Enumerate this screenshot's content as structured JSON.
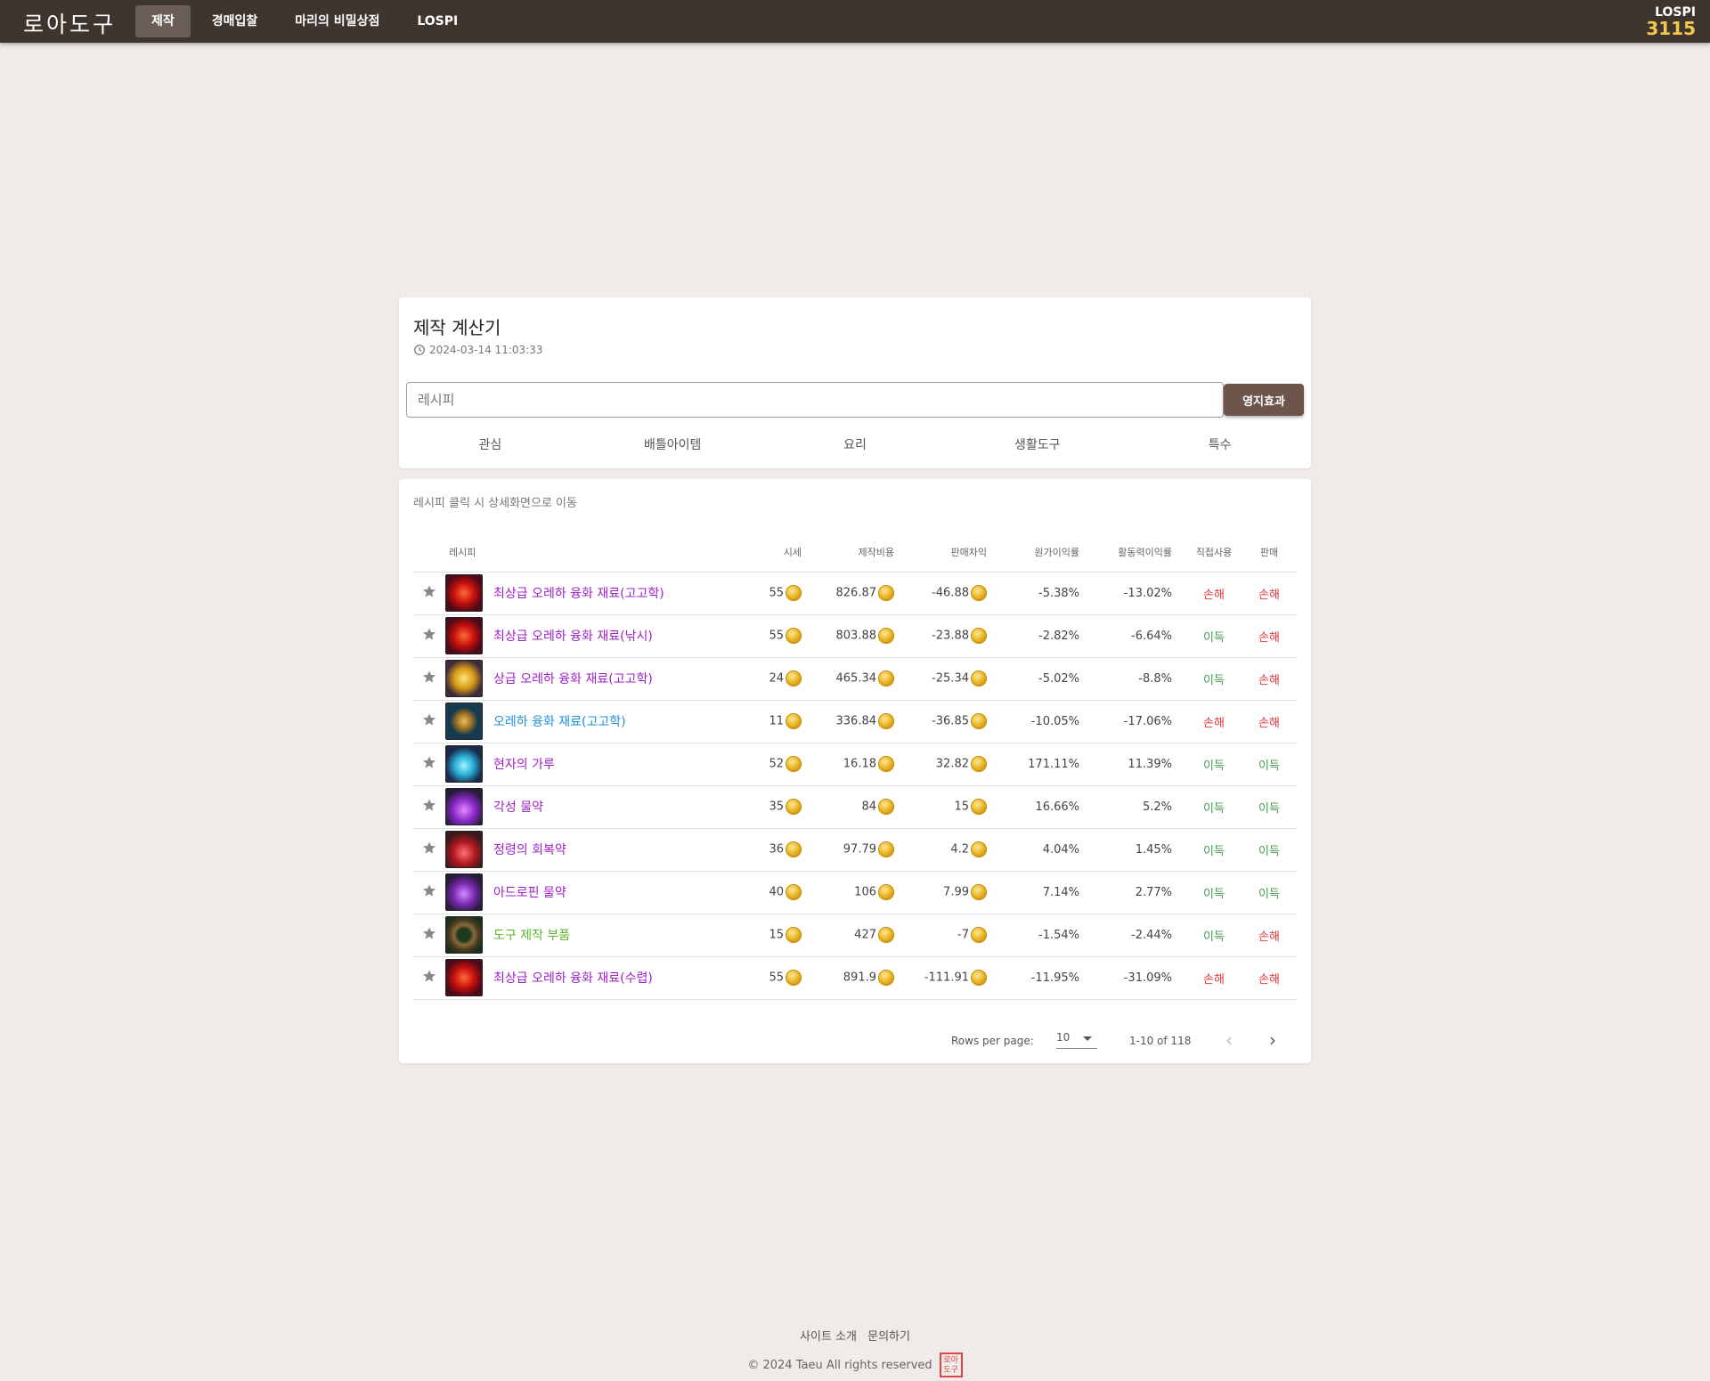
{
  "header": {
    "logo": "로아도구",
    "nav": [
      "제작",
      "경매입찰",
      "마리의 비밀상점",
      "LOSPI"
    ],
    "lospi_label": "LOSPI",
    "lospi_value": "3115"
  },
  "calculator": {
    "title": "제작 계산기",
    "timestamp": "2024-03-14 11:03:33",
    "search_placeholder": "레시피",
    "effect_button": "영지효과",
    "tabs": [
      "관심",
      "배틀아이템",
      "요리",
      "생활도구",
      "특수"
    ]
  },
  "table": {
    "hint": "레시피 클릭 시 상세화면으로 이동",
    "headers": [
      "레시피",
      "시세",
      "제작비용",
      "판매차익",
      "원가이익률",
      "활동력이익률",
      "직접사용",
      "판매"
    ],
    "rows": [
      {
        "name": "최상급 오레하 융화 재료(고고학)",
        "name_color": "#a020c8",
        "icon": "red-gem-icon",
        "price": "55",
        "cost": "826.87",
        "profit": "-46.88",
        "cost_rate": "-5.38%",
        "energy_rate": "-13.02%",
        "use": "손해",
        "sell": "손해"
      },
      {
        "name": "최상급 오레하 융화 재료(낚시)",
        "name_color": "#a020c8",
        "icon": "red-gem-icon",
        "price": "55",
        "cost": "803.88",
        "profit": "-23.88",
        "cost_rate": "-2.82%",
        "energy_rate": "-6.64%",
        "use": "이득",
        "sell": "손해"
      },
      {
        "name": "상급 오레하 융화 재료(고고학)",
        "name_color": "#a020c8",
        "icon": "gold-gem-icon",
        "price": "24",
        "cost": "465.34",
        "profit": "-25.34",
        "cost_rate": "-5.02%",
        "energy_rate": "-8.8%",
        "use": "이득",
        "sell": "손해"
      },
      {
        "name": "오레하 융화 재료(고고학)",
        "name_color": "#1e90e0",
        "icon": "gold-nugget-icon",
        "price": "11",
        "cost": "336.84",
        "profit": "-36.85",
        "cost_rate": "-10.05%",
        "energy_rate": "-17.06%",
        "use": "손해",
        "sell": "손해"
      },
      {
        "name": "현자의 가루",
        "name_color": "#a020c8",
        "icon": "crystal-powder-icon",
        "price": "52",
        "cost": "16.18",
        "profit": "32.82",
        "cost_rate": "171.11%",
        "energy_rate": "11.39%",
        "use": "이득",
        "sell": "이득"
      },
      {
        "name": "각성 물약",
        "name_color": "#a020c8",
        "icon": "purple-potion-icon",
        "price": "35",
        "cost": "84",
        "profit": "15",
        "cost_rate": "16.66%",
        "energy_rate": "5.2%",
        "use": "이득",
        "sell": "이득"
      },
      {
        "name": "정령의 회복약",
        "name_color": "#a020c8",
        "icon": "red-potion-icon",
        "price": "36",
        "cost": "97.79",
        "profit": "4.2",
        "cost_rate": "4.04%",
        "energy_rate": "1.45%",
        "use": "이득",
        "sell": "이득"
      },
      {
        "name": "아드로핀 물약",
        "name_color": "#a020c8",
        "icon": "violet-potion-icon",
        "price": "40",
        "cost": "106",
        "profit": "7.99",
        "cost_rate": "7.14%",
        "energy_rate": "2.77%",
        "use": "이득",
        "sell": "이득"
      },
      {
        "name": "도구 제작 부품",
        "name_color": "#5cb82a",
        "icon": "wreath-parts-icon",
        "price": "15",
        "cost": "427",
        "profit": "-7",
        "cost_rate": "-1.54%",
        "energy_rate": "-2.44%",
        "use": "이득",
        "sell": "손해"
      },
      {
        "name": "최상급 오레하 융화 재료(수렵)",
        "name_color": "#a020c8",
        "icon": "red-gem-icon",
        "price": "55",
        "cost": "891.9",
        "profit": "-111.91",
        "cost_rate": "-11.95%",
        "energy_rate": "-31.09%",
        "use": "손해",
        "sell": "손해"
      }
    ]
  },
  "pagination": {
    "rows_per_page_label": "Rows per page:",
    "rows_per_page": "10",
    "range": "1-10 of 118"
  },
  "footer": {
    "links": [
      "사이트 소개",
      "문의하기"
    ],
    "copyright": "© 2024 Taeu All rights reserved",
    "stamp": "로아도구"
  },
  "colors": {
    "topbar": "#3f352f",
    "accent_button": "#6d554b",
    "loss": "#e53935",
    "gain": "#43a047",
    "lospi_value": "#f2c94c"
  }
}
